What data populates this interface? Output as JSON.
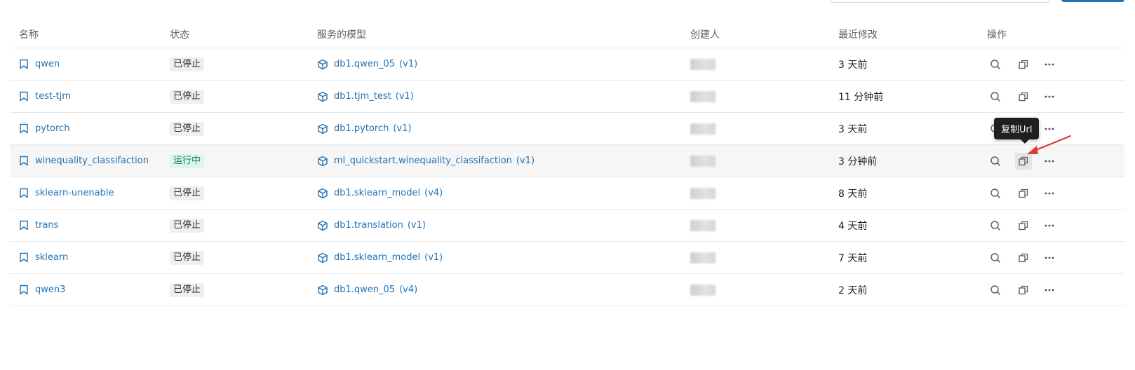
{
  "table": {
    "headers": {
      "name": "名称",
      "status": "状态",
      "model": "服务的模型",
      "creator": "创建人",
      "modified": "最近修改",
      "actions": "操作"
    },
    "rows": [
      {
        "name": "qwen",
        "status": "已停止",
        "running": false,
        "model": "db1.qwen_05",
        "version": "(v1)",
        "modified": "3 天前"
      },
      {
        "name": "test-tjm",
        "status": "已停止",
        "running": false,
        "model": "db1.tjm_test",
        "version": "(v1)",
        "modified": "11 分钟前"
      },
      {
        "name": "pytorch",
        "status": "已停止",
        "running": false,
        "model": "db1.pytorch",
        "version": "(v1)",
        "modified": "3 天前"
      },
      {
        "name": "winequality_classifaction",
        "status": "运行中",
        "running": true,
        "model": "ml_quickstart.winequality_classifaction",
        "version": "(v1)",
        "modified": "3 分钟前"
      },
      {
        "name": "sklearn-unenable",
        "status": "已停止",
        "running": false,
        "model": "db1.sklearn_model",
        "version": "(v4)",
        "modified": "8 天前"
      },
      {
        "name": "trans",
        "status": "已停止",
        "running": false,
        "model": "db1.translation",
        "version": "(v1)",
        "modified": "4 天前"
      },
      {
        "name": "sklearn",
        "status": "已停止",
        "running": false,
        "model": "db1.sklearn_model",
        "version": "(v1)",
        "modified": "7 天前"
      },
      {
        "name": "qwen3",
        "status": "已停止",
        "running": false,
        "model": "db1.qwen_05",
        "version": "(v4)",
        "modified": "2 天前"
      }
    ]
  },
  "tooltip": {
    "text": "复制Url"
  },
  "colors": {
    "link": "#2272b4",
    "running_bg": "#d9f7ec",
    "running_text": "#1b7a52",
    "stopped_bg": "#efefef",
    "annotation_arrow": "#e53935"
  },
  "icons": {
    "name": "bookmark-icon",
    "model": "cube-icon",
    "action_view": "search-icon",
    "action_copy": "copy-icon",
    "action_more": "more-icon"
  }
}
